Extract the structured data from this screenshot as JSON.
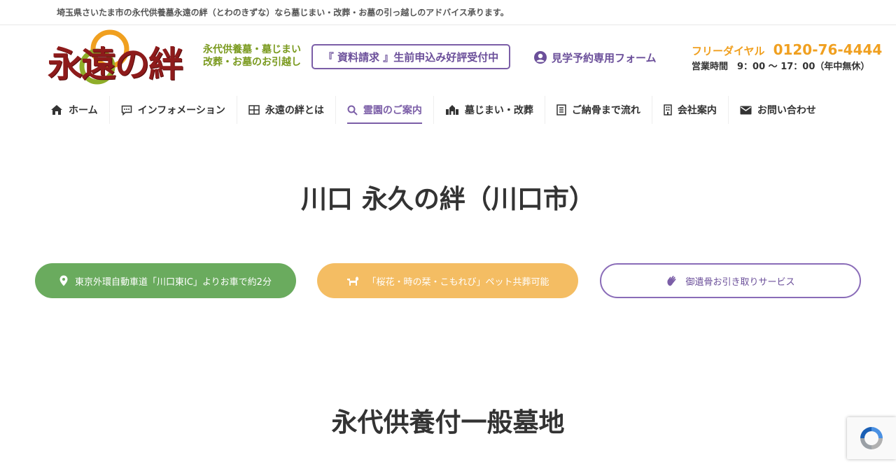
{
  "topbar": {
    "text": "埼玉県さいたま市の永代供養墓永遠の絆（とわのきずな）なら墓じまい・改葬・お墓の引っ越しのアドバイス承ります。"
  },
  "logo": {
    "text": "永遠の絆",
    "ruby_left": "と",
    "ruby_right": "わ"
  },
  "header": {
    "tagline": [
      "永代供養墓・墓じまい",
      "改葬・お墓のお引越し"
    ],
    "shiryo_button": "『 資料請求 』生前申込み好評受付中",
    "kengaku_link": "見学予約専用フォーム",
    "phone_label": "フリーダイヤル",
    "phone_number": "0120-76-4444",
    "hours": "営業時間　9：00 ～ 17：00（年中無休）"
  },
  "nav": {
    "items": [
      {
        "label": "ホーム",
        "icon": "home-icon"
      },
      {
        "label": "インフォメーション",
        "icon": "chat-icon"
      },
      {
        "label": "永遠の絆とは",
        "icon": "grid-icon"
      },
      {
        "label": "霊園のご案内",
        "icon": "search-icon",
        "active": true
      },
      {
        "label": "墓じまい・改葬",
        "icon": "building-icon"
      },
      {
        "label": "ご納骨まで流れ",
        "icon": "document-icon"
      },
      {
        "label": "会社案内",
        "icon": "office-icon"
      },
      {
        "label": "お問い合わせ",
        "icon": "mail-icon"
      }
    ]
  },
  "main": {
    "title": "川口 永久の絆（川口市）",
    "pills": [
      {
        "label": "東京外環自動車道「川口東IC」よりお車で約2分",
        "icon": "map-pin-icon"
      },
      {
        "label": "「桜花・時の栞・こもれび」ペット共葬可能",
        "icon": "dog-icon"
      },
      {
        "label": "御遺骨お引き取りサービス",
        "icon": "hand-wave-icon"
      }
    ],
    "section_title": "永代供養付一般墓地"
  },
  "colors": {
    "accent_purple": "#7b5ea7",
    "green": "#6aab5e",
    "orange": "#f4bd63",
    "phone_orange": "#f0a020",
    "logo_red": "#8e1b1b",
    "tagline_green": "#7a9a1e"
  }
}
